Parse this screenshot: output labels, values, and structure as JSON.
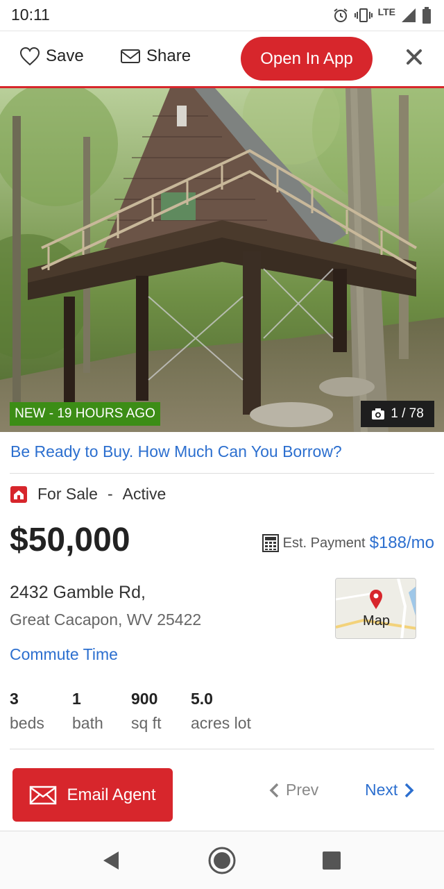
{
  "status_bar": {
    "time": "10:11",
    "network": "LTE"
  },
  "header": {
    "save_label": "Save",
    "share_label": "Share",
    "open_app_label": "Open In App"
  },
  "photo": {
    "badge": "NEW - 19 HOURS AGO",
    "counter": "1 / 78"
  },
  "finance_link": "Be Ready to Buy. How Much Can You Borrow?",
  "listing": {
    "sale_type": "For Sale",
    "separator": "-",
    "state": "Active",
    "price": "$50,000",
    "est_payment_label": "Est. Payment",
    "est_payment_value": "$188/mo",
    "address_line1": "2432 Gamble Rd,",
    "address_line2": "Great Cacapon, WV 25422",
    "map_label": "Map",
    "commute_label": "Commute Time"
  },
  "stats": [
    {
      "value": "3",
      "label": "beds"
    },
    {
      "value": "1",
      "label": "bath"
    },
    {
      "value": "900",
      "label": "sq ft"
    },
    {
      "value": "5.0",
      "label": "acres lot"
    }
  ],
  "footer": {
    "email_agent_label": "Email Agent",
    "prev_label": "Prev",
    "next_label": "Next"
  },
  "colors": {
    "brand_red": "#d7262c",
    "link_blue": "#2c6fcf",
    "new_badge_green": "#3c8d16"
  },
  "icons": [
    "alarm-icon",
    "vibrate-icon",
    "signal-icon",
    "battery-icon",
    "heart-icon",
    "mail-icon",
    "close-icon",
    "camera-icon",
    "home-sale-icon",
    "calculator-icon",
    "map-pin-icon",
    "envelope-icon",
    "chevron-left-icon",
    "chevron-right-icon",
    "nav-back-icon",
    "nav-home-icon",
    "nav-recents-icon"
  ]
}
